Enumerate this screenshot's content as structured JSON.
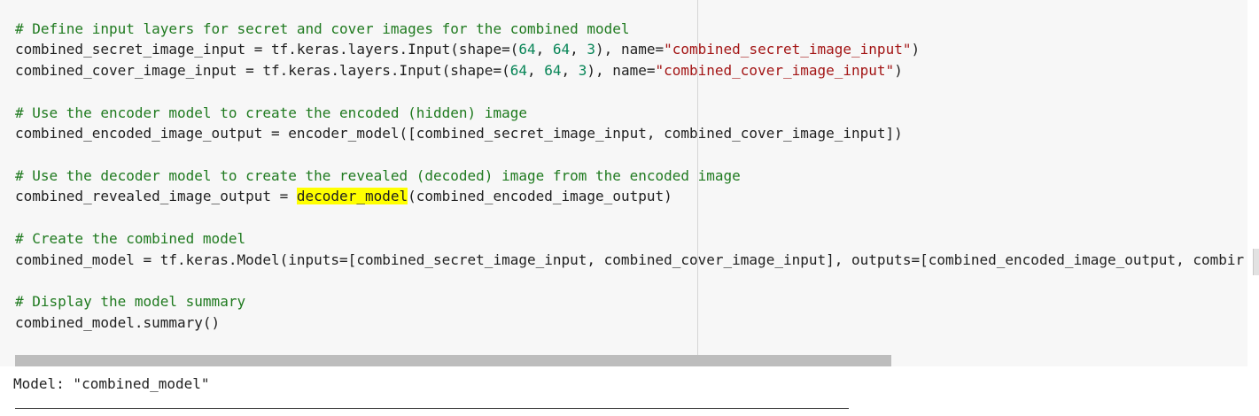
{
  "code": {
    "l1": "# Define input layers for secret and cover images for the combined model",
    "l2": {
      "a": "combined_secret_image_input = tf.keras.layers.Input(shape=(",
      "n1": "64",
      "s1": ", ",
      "n2": "64",
      "s2": ", ",
      "n3": "3",
      "b": "), name=",
      "str": "\"combined_secret_image_input\"",
      "c": ")"
    },
    "l3": {
      "a": "combined_cover_image_input = tf.keras.layers.Input(shape=(",
      "n1": "64",
      "s1": ", ",
      "n2": "64",
      "s2": ", ",
      "n3": "3",
      "b": "), name=",
      "str": "\"combined_cover_image_input\"",
      "c": ")"
    },
    "l4": "# Use the encoder model to create the encoded (hidden) image",
    "l5": "combined_encoded_image_output = encoder_model([combined_secret_image_input, combined_cover_image_input])",
    "l6": "# Use the decoder model to create the revealed (decoded) image from the encoded image",
    "l7": {
      "a": "combined_revealed_image_output = ",
      "hl": "decoder_model",
      "b": "(combined_encoded_image_output)"
    },
    "l8": "# Create the combined model",
    "l9": "combined_model = tf.keras.Model(inputs=[combined_secret_image_input, combined_cover_image_input], outputs=[combined_encoded_image_output, combir",
    "l10": "# Display the model summary",
    "l11": "combined_model.summary()"
  },
  "output": {
    "title": "Model: \"combined_model\""
  },
  "colors": {
    "comment": "#1f7a1f",
    "number": "#098658",
    "string": "#a31515",
    "highlight": "#ffff00",
    "cell_bg": "#f7f7f7"
  }
}
